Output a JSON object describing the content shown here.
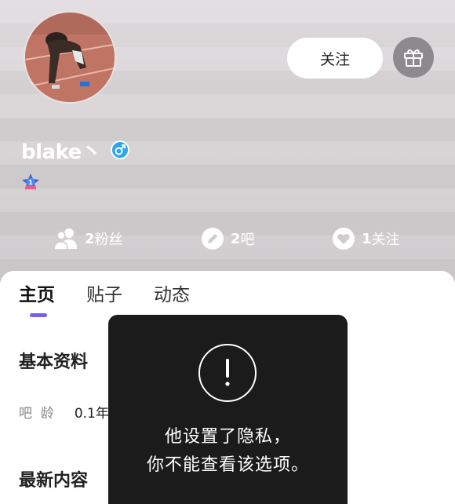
{
  "profile": {
    "username": "blake丶",
    "gender_icon": "male-icon",
    "level": "1",
    "level_icon": "star-level-icon"
  },
  "actions": {
    "follow_label": "关注",
    "gift_icon": "gift-icon"
  },
  "stats": [
    {
      "icon": "fans-icon",
      "num": "2",
      "label": "粉丝"
    },
    {
      "icon": "pencil-icon",
      "num": "2",
      "label": "吧"
    },
    {
      "icon": "heart-icon",
      "num": "1",
      "label": "关注"
    }
  ],
  "tabs": [
    {
      "label": "主页",
      "active": true
    },
    {
      "label": "贴子",
      "active": false
    },
    {
      "label": "动态",
      "active": false
    }
  ],
  "sections": {
    "basic_info": "基本资料",
    "bar_age_label": "吧  龄",
    "bar_age_value": "0.1年",
    "latest": "最新内容"
  },
  "toast": {
    "icon": "exclamation-icon",
    "line1": "他设置了隐私，",
    "line2": "你不能查看该选项。"
  },
  "colors": {
    "accent": "#7560e6",
    "gender_badge": "#2aa6f2",
    "toast_bg": "#1b1b1b"
  }
}
